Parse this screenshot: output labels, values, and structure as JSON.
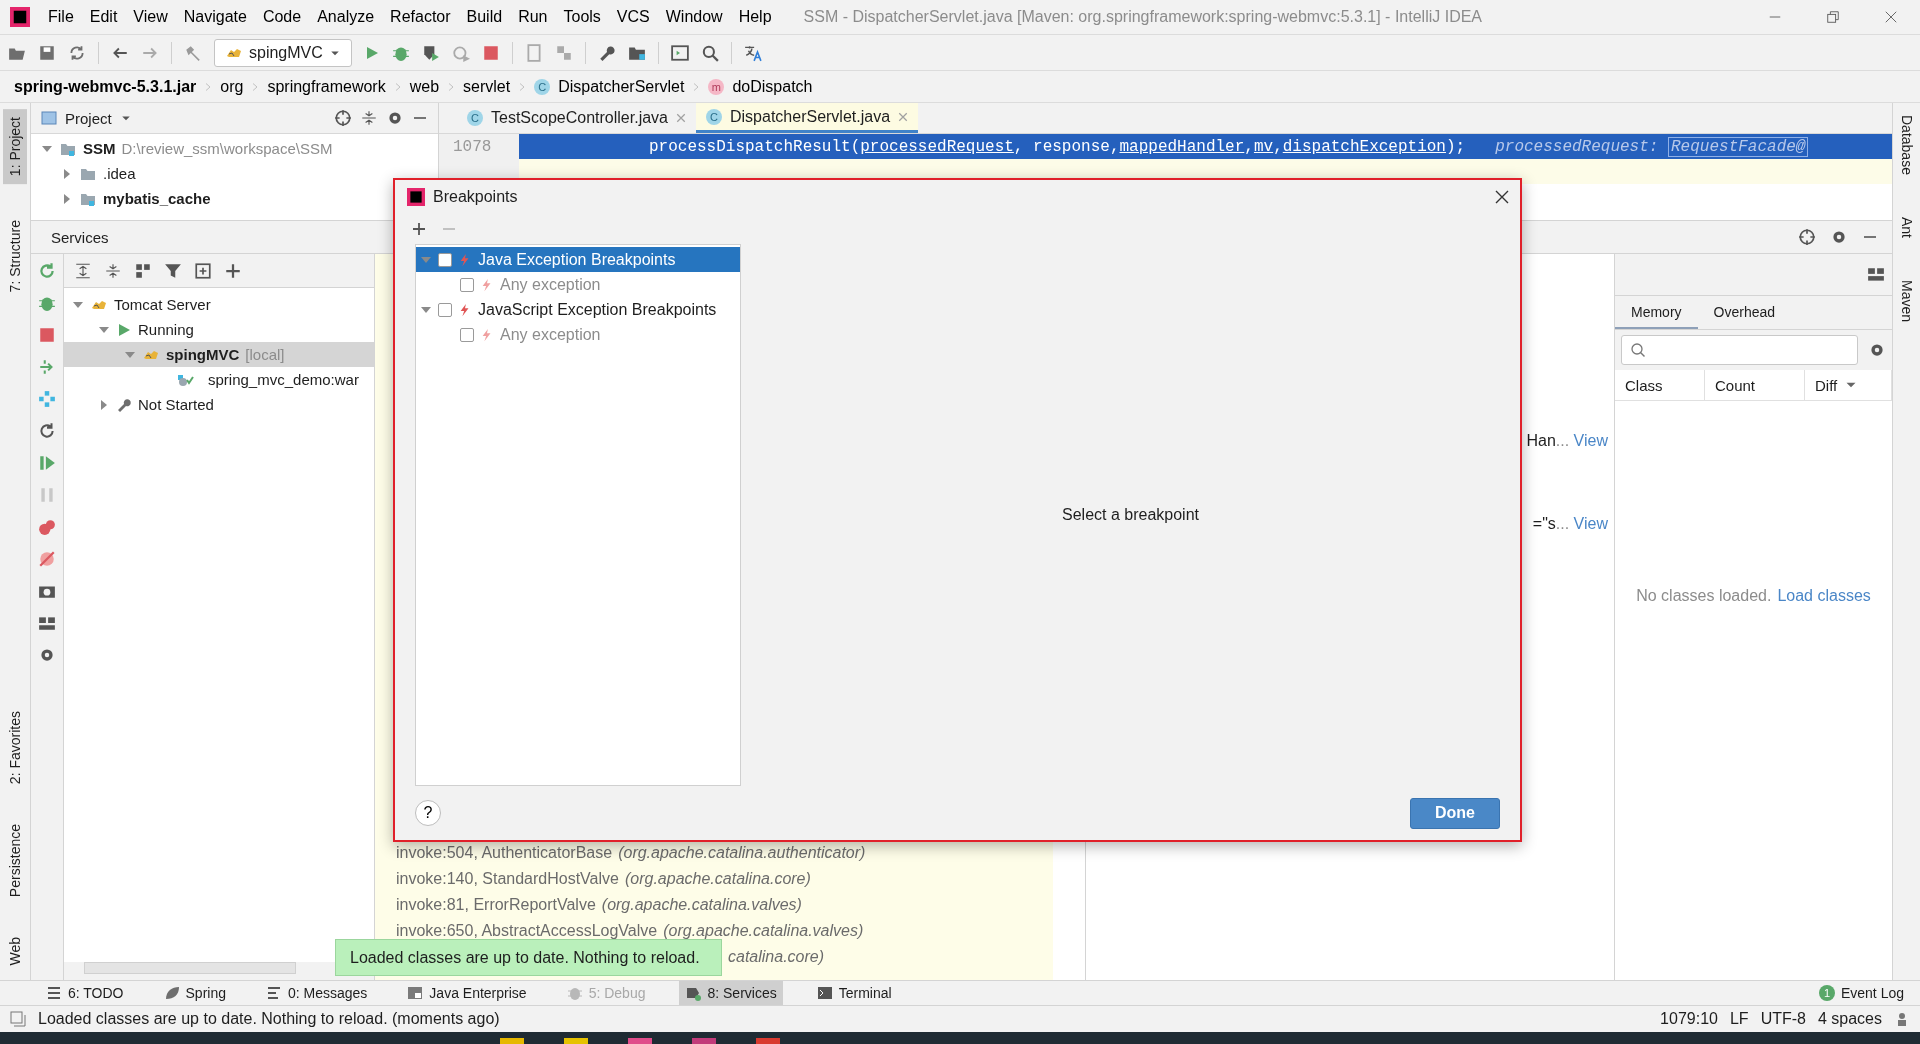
{
  "window": {
    "title": "SSM - DispatcherServlet.java [Maven: org.springframework:spring-webmvc:5.3.1] - IntelliJ IDEA"
  },
  "menu": [
    "File",
    "Edit",
    "View",
    "Navigate",
    "Code",
    "Analyze",
    "Refactor",
    "Build",
    "Run",
    "Tools",
    "VCS",
    "Window",
    "Help"
  ],
  "toolbar": {
    "run_config": "spingMVC"
  },
  "breadcrumb": [
    {
      "label": "spring-webmvc-5.3.1.jar",
      "kind": "jar"
    },
    {
      "label": "org",
      "kind": "plain"
    },
    {
      "label": "springframework",
      "kind": "plain"
    },
    {
      "label": "web",
      "kind": "plain"
    },
    {
      "label": "servlet",
      "kind": "plain"
    },
    {
      "label": "DispatcherServlet",
      "kind": "class",
      "badge": "C"
    },
    {
      "label": "doDispatch",
      "kind": "method",
      "badge": "m"
    }
  ],
  "left_stripe_top": [
    {
      "label": "1: Project",
      "selected": true
    },
    {
      "label": "7: Structure",
      "selected": false
    }
  ],
  "left_stripe_bottom": [
    {
      "label": "2: Favorites",
      "selected": false
    },
    {
      "label": "Persistence",
      "selected": false
    },
    {
      "label": "Web",
      "selected": false
    }
  ],
  "right_stripe": [
    {
      "label": "Database"
    },
    {
      "label": "Ant"
    },
    {
      "label": "Maven"
    }
  ],
  "project_panel": {
    "title": "Project",
    "tree": [
      {
        "label": "SSM",
        "path": "D:\\review_ssm\\workspace\\SSM",
        "expanded": true,
        "bold": true,
        "children": [
          {
            "label": ".idea",
            "expanded": false,
            "bold": false
          },
          {
            "label": "mybatis_cache",
            "expanded": false,
            "bold": true
          }
        ]
      }
    ]
  },
  "editor": {
    "tabs": [
      {
        "label": "TestScopeController.java",
        "badge": "C",
        "selected": false
      },
      {
        "label": "DispatcherServlet.java",
        "badge": "C",
        "selected": true
      }
    ],
    "line_number": "1078",
    "code": [
      {
        "text": "processDispatchResult(",
        "underline": false
      },
      {
        "text": "processedRequest",
        "underline": true
      },
      {
        "text": ", response, ",
        "underline": false
      },
      {
        "text": "mappedHandler",
        "underline": true
      },
      {
        "text": ", ",
        "underline": false
      },
      {
        "text": "mv",
        "underline": true
      },
      {
        "text": ", ",
        "underline": false
      },
      {
        "text": "dispatchException",
        "underline": true
      },
      {
        "text": ");",
        "underline": false
      }
    ],
    "hint_name": "processedRequest:",
    "hint_value": "RequestFacade@"
  },
  "services": {
    "title": "Services",
    "tree": [
      {
        "label": "Tomcat Server",
        "kind": "server",
        "expanded": true,
        "selected": false,
        "children": [
          {
            "label": "Running",
            "kind": "group",
            "expanded": true,
            "selected": false,
            "children": [
              {
                "label": "spingMVC",
                "suffix": "[local]",
                "kind": "server",
                "expanded": true,
                "selected": true,
                "children": [
                  {
                    "label": "spring_mvc_demo:war",
                    "kind": "artifact",
                    "selected": false
                  }
                ]
              }
            ]
          },
          {
            "label": "Not Started",
            "kind": "idle",
            "expanded": false,
            "selected": false
          }
        ]
      }
    ]
  },
  "frames": [
    {
      "method": "invoke:504, AuthenticatorBase",
      "package": "(org.apache.catalina.authenticator)"
    },
    {
      "method": "invoke:140, StandardHostValve",
      "package": "(org.apache.catalina.core)"
    },
    {
      "method": "invoke:81, ErrorReportValve",
      "package": "(org.apache.catalina.valves)"
    },
    {
      "method": "invoke:650, AbstractAccessLogValve",
      "package": "(org.apache.catalina.valves)"
    },
    {
      "package": "catalina.core)"
    }
  ],
  "variables": [
    {
      "text": "Han",
      "ellipsis": "...",
      "link": "View"
    },
    {
      "text": "=\"s",
      "ellipsis": "...",
      "link": "View"
    }
  ],
  "memory": {
    "tabs": [
      {
        "label": "Memory",
        "selected": true
      },
      {
        "label": "Overhead",
        "selected": false
      }
    ],
    "columns": [
      "Class",
      "Count",
      "Diff"
    ],
    "empty_text": "No classes loaded.",
    "empty_link": "Load classes"
  },
  "dialog": {
    "title": "Breakpoints",
    "tree": [
      {
        "label": "Java Exception Breakpoints",
        "checked": false,
        "expanded": true,
        "selected": true,
        "children": [
          {
            "label": "Any exception",
            "checked": false,
            "selected": false
          }
        ]
      },
      {
        "label": "JavaScript Exception Breakpoints",
        "checked": false,
        "expanded": true,
        "selected": false,
        "children": [
          {
            "label": "Any exception",
            "checked": false,
            "selected": false
          }
        ]
      }
    ],
    "placeholder_text": "Select a breakpoint",
    "help": "?",
    "done": "Done"
  },
  "notification": "Loaded classes are up to date. Nothing to reload.",
  "tool_windows": [
    {
      "label": "6: TODO",
      "kind": "todo",
      "selected": false,
      "disabled": false
    },
    {
      "label": "Spring",
      "kind": "spring",
      "selected": false,
      "disabled": false
    },
    {
      "label": "0: Messages",
      "kind": "messages",
      "selected": false,
      "disabled": false
    },
    {
      "label": "Java Enterprise",
      "kind": "enterprise",
      "selected": false,
      "disabled": false
    },
    {
      "label": "5: Debug",
      "kind": "debug",
      "selected": false,
      "disabled": true
    },
    {
      "label": "8: Services",
      "kind": "services",
      "selected": true,
      "disabled": false
    },
    {
      "label": "Terminal",
      "kind": "terminal",
      "selected": false,
      "disabled": false
    }
  ],
  "event_log": {
    "label": "Event Log",
    "count": "1"
  },
  "status": {
    "message": "Loaded classes are up to date. Nothing to reload. (moments ago)",
    "position": "1079:10",
    "line_sep": "LF",
    "encoding": "UTF-8",
    "indent": "4 spaces"
  }
}
